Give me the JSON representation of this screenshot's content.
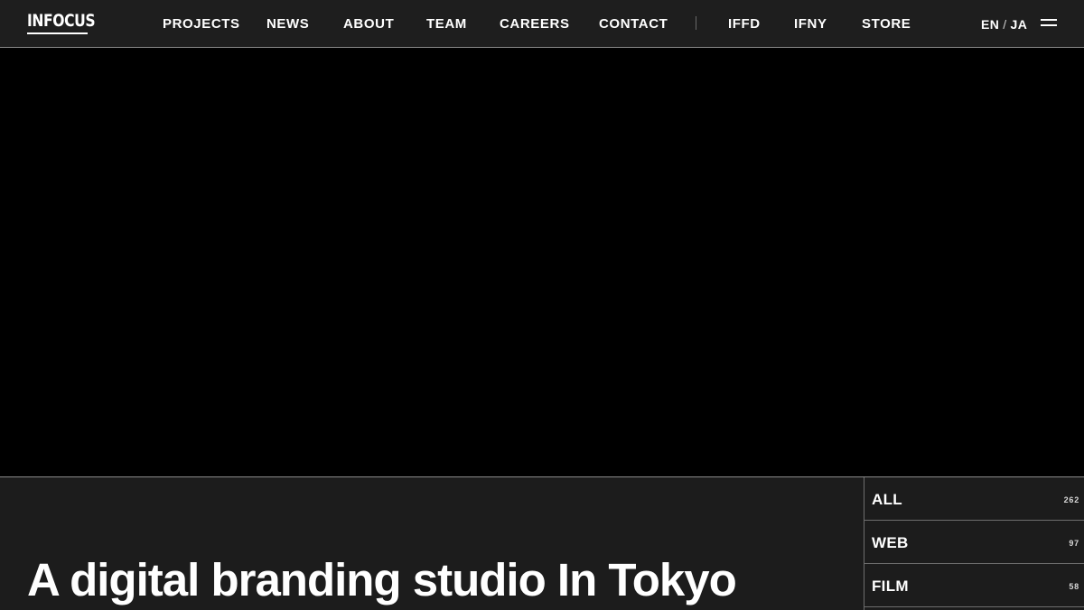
{
  "brand": {
    "logo_text": "INFOCUS"
  },
  "nav": {
    "items": [
      {
        "label": "PROJECTS"
      },
      {
        "label": "NEWS"
      },
      {
        "label": "ABOUT"
      },
      {
        "label": "TEAM"
      },
      {
        "label": "CAREERS"
      },
      {
        "label": "CONTACT"
      },
      {
        "label": "IFFD"
      },
      {
        "label": "IFNY"
      },
      {
        "label": "STORE"
      }
    ]
  },
  "language": {
    "en": "EN",
    "separator": "/",
    "ja": "JA"
  },
  "menu": {
    "icon": "hamburger-menu-icon"
  },
  "hero": {
    "media_state": "black video frame"
  },
  "main": {
    "tagline": "A digital branding studio In Tokyo"
  },
  "filters": [
    {
      "label": "ALL",
      "count": "262"
    },
    {
      "label": "WEB",
      "count": "97"
    },
    {
      "label": "FILM",
      "count": "58"
    }
  ],
  "colors": {
    "header_bg": "#1e1e1e",
    "hero_bg": "#000000",
    "page_bg": "#1c1c1c",
    "text": "#ffffff",
    "divider": "#8a8a8a"
  }
}
